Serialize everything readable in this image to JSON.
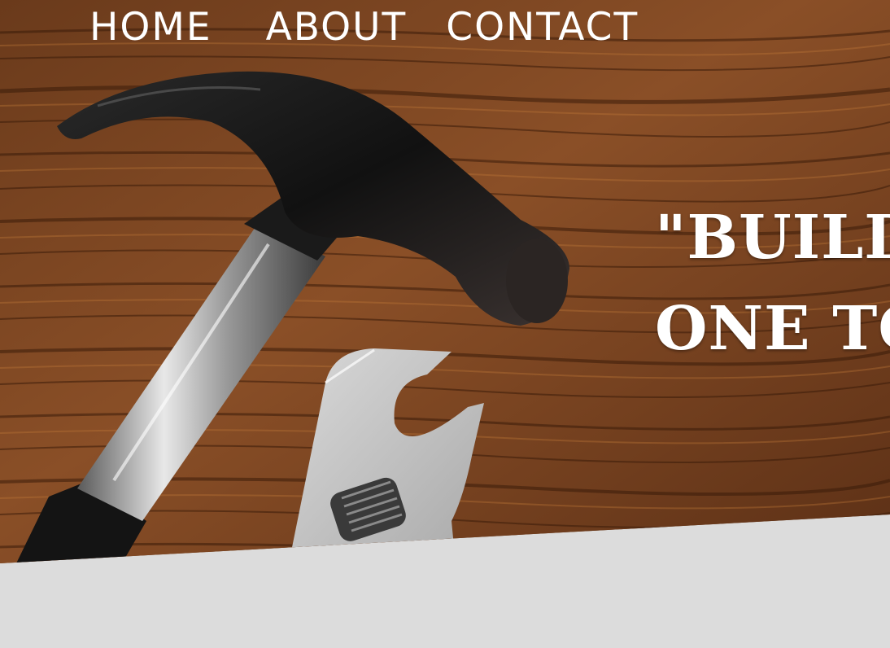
{
  "nav": {
    "items": [
      {
        "label": "HOME"
      },
      {
        "label": "ABOUT"
      },
      {
        "label": "CONTACT"
      }
    ]
  },
  "hero": {
    "tagline_line1": "\"BUILD",
    "tagline_line2": "ONE TO"
  },
  "colors": {
    "wood_base": "#7a4522",
    "wood_dark": "#3e1f0d",
    "section_bg": "#dcdcdc",
    "text": "#ffffff"
  },
  "icons": [
    "hammer-image",
    "wrench-image"
  ]
}
